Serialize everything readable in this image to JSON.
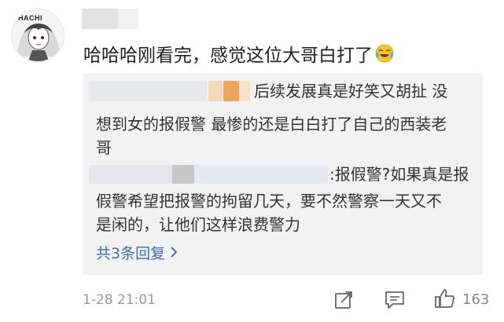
{
  "comment": {
    "avatar_text": "HACHI",
    "text": "哈哈哈刚看完，感觉这位大哥白打了",
    "emoji": "laughing-crying-emoji"
  },
  "replies": [
    {
      "lines": [
        "后续发展真是好笑又胡扯 没",
        "想到女的报假警 最惨的还是白白打了自己的西装老",
        "哥"
      ]
    },
    {
      "lines": [
        ":报假警?如果真是报",
        "假警希望把报警的拘留几天，要不然警察一天又不",
        "是闲的，让他们这样浪费警力"
      ]
    }
  ],
  "more_replies": {
    "label": "共3条回复",
    "icon": "chevron-right-icon"
  },
  "footer": {
    "time": "1-28 21:01",
    "icons": [
      "share-edit-icon",
      "comment-icon",
      "like-icon"
    ],
    "likes": "163"
  },
  "colors": {
    "link": "#3f6fb0",
    "reply_bg": "#f2f2f2",
    "muted": "#999999"
  }
}
